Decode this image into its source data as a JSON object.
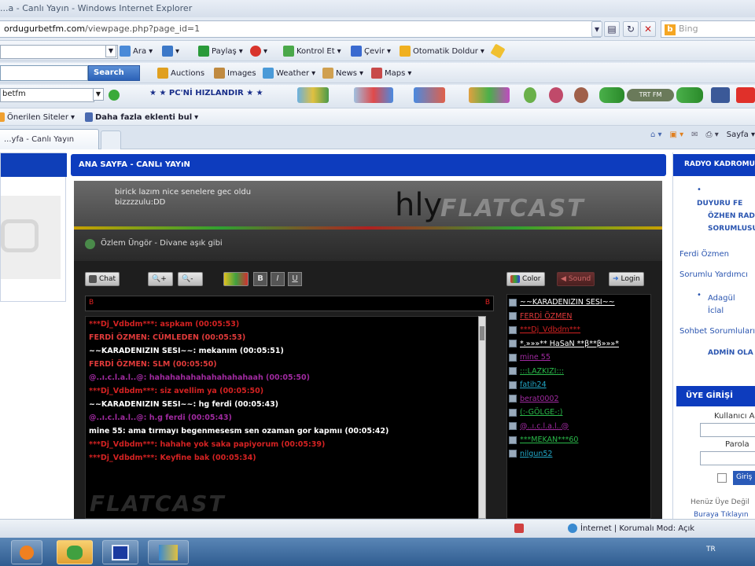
{
  "window": {
    "title": "...a - Canlı Yayın - Windows Internet Explorer"
  },
  "address": {
    "url_prefix": "",
    "domain": "ordugurbetfm.com",
    "path": "/viewpage.php?page_id=1"
  },
  "bing": {
    "placeholder": "Bing"
  },
  "toolbar1": {
    "ara": "Ara",
    "paylas": "Paylaş",
    "kontrol": "Kontrol Et",
    "cevir": "Çevir",
    "otomatik": "Otomatik Doldur"
  },
  "toolbar2": {
    "search": "Search",
    "auctions": "Auctions",
    "images": "Images",
    "weather": "Weather",
    "news": "News",
    "maps": "Maps"
  },
  "toolbar3": {
    "input": "betfm",
    "radio": "★ ★ PC'Nİ HIZLANDIR ★ ★",
    "tr": "TRT FM"
  },
  "favorites": {
    "onerilen": "Önerilen Siteler",
    "eklenti": "Daha fazla eklenti bul"
  },
  "tab": {
    "label": "...yfa - Canlı Yayın"
  },
  "cmdbar": {
    "sayfa": "Sayfa"
  },
  "center": {
    "header": "ANA SAYFA - CANLı YAYıN"
  },
  "right": {
    "header": "RADYO KADROMU",
    "links": [
      "DUYURU FE",
      "ÖZHEN RAD",
      "SORUMLUSU",
      "Ferdi Özmen",
      "Sorumlu Yardımcı",
      "Adagül",
      "İclal",
      "Sohbet Sorumluları",
      "ADMİN OLA"
    ],
    "uye_header": "ÜYE GİRİŞİ",
    "kullanici": "Kullanıcı A",
    "parola": "Parola",
    "giris": "Giriş",
    "henuz": "Henüz Üye Değil",
    "burava": "Buraya Tıklayın"
  },
  "flatcast": {
    "banner_msg1": "birick lazım nice senelere gec oldu",
    "banner_msg2": "bizzzzulu:DD",
    "banner_hly": "hly",
    "logo": "FLATCAST",
    "song": "Özlem Üngör - Divane aşık gibi",
    "btn_chat": "Chat",
    "btn_color": "Color",
    "btn_sound": "Sound",
    "btn_login": "Login",
    "btn_b": "B",
    "btn_i": "I",
    "btn_u": "U",
    "input_left": "B",
    "input_right": "B"
  },
  "chat": [
    {
      "text": "***Dj_Vdbdm***:  aspkam (00:05:53)",
      "color": "#d42222"
    },
    {
      "text": "FERDİ ÖZMEN: CÜMLEDEN (00:05:53)",
      "color": "#e03a3a"
    },
    {
      "text": "~~KARADENIZIN SESI~~: mekanım (00:05:51)",
      "color": "#ffffff"
    },
    {
      "text": "FERDİ ÖZMEN: SLM (00:05:50)",
      "color": "#e03a3a"
    },
    {
      "text": "@..ı.c.l.a.l..@: hahahahahahahahahahaah (00:05:50)",
      "color": "#a02aa0"
    },
    {
      "text": "***Dj_Vdbdm***: siz avellim ya (00:05:50)",
      "color": "#d42222"
    },
    {
      "text": "~~KARADENIZIN SESI~~: hg ferdi (00:05:43)",
      "color": "#ffffff"
    },
    {
      "text": "@..ı.c.l.a.l..@: h.g ferdi (00:05:43)",
      "color": "#a02aa0"
    },
    {
      "text": "mine 55:  ama tırmayı begenmesesm sen ozaman gor kapmıı (00:05:42)",
      "color": "#ffffff"
    },
    {
      "text": "***Dj_Vdbdm***: hahahe yok saka papiyorum (00:05:39)",
      "color": "#d42222"
    },
    {
      "text": "***Dj_Vdbdm***: Keyfine bak (00:05:34)",
      "color": "#d42222"
    }
  ],
  "users": [
    {
      "name": "~~KARADENIZIN SESI~~",
      "color": "#ffffff"
    },
    {
      "name": "FERDİ ÖZMEN",
      "color": "#e03a3a"
    },
    {
      "name": "***Dj_Vdbdm***",
      "color": "#d42222"
    },
    {
      "name": "*.»»»** HaSaN **β**β»»»*",
      "color": "#ffffff"
    },
    {
      "name": "mine 55",
      "color": "#a02aa0"
    },
    {
      "name": ":::LAZKIZI:::",
      "color": "#2ab84a"
    },
    {
      "name": "fatih24",
      "color": "#22a8c8"
    },
    {
      "name": "berat0002",
      "color": "#a02aa0"
    },
    {
      "name": "(:-GÖLGE-:)",
      "color": "#2ab84a"
    },
    {
      "name": "@..ı.c.l.a.l..@",
      "color": "#a02aa0"
    },
    {
      "name": "***MEKAN***60",
      "color": "#2ab84a"
    },
    {
      "name": "nilgun52",
      "color": "#22a8c8"
    }
  ],
  "status": {
    "zone": "İnternet | Korumalı Mod: Açık"
  },
  "taskbar": {
    "tray": "TR"
  }
}
